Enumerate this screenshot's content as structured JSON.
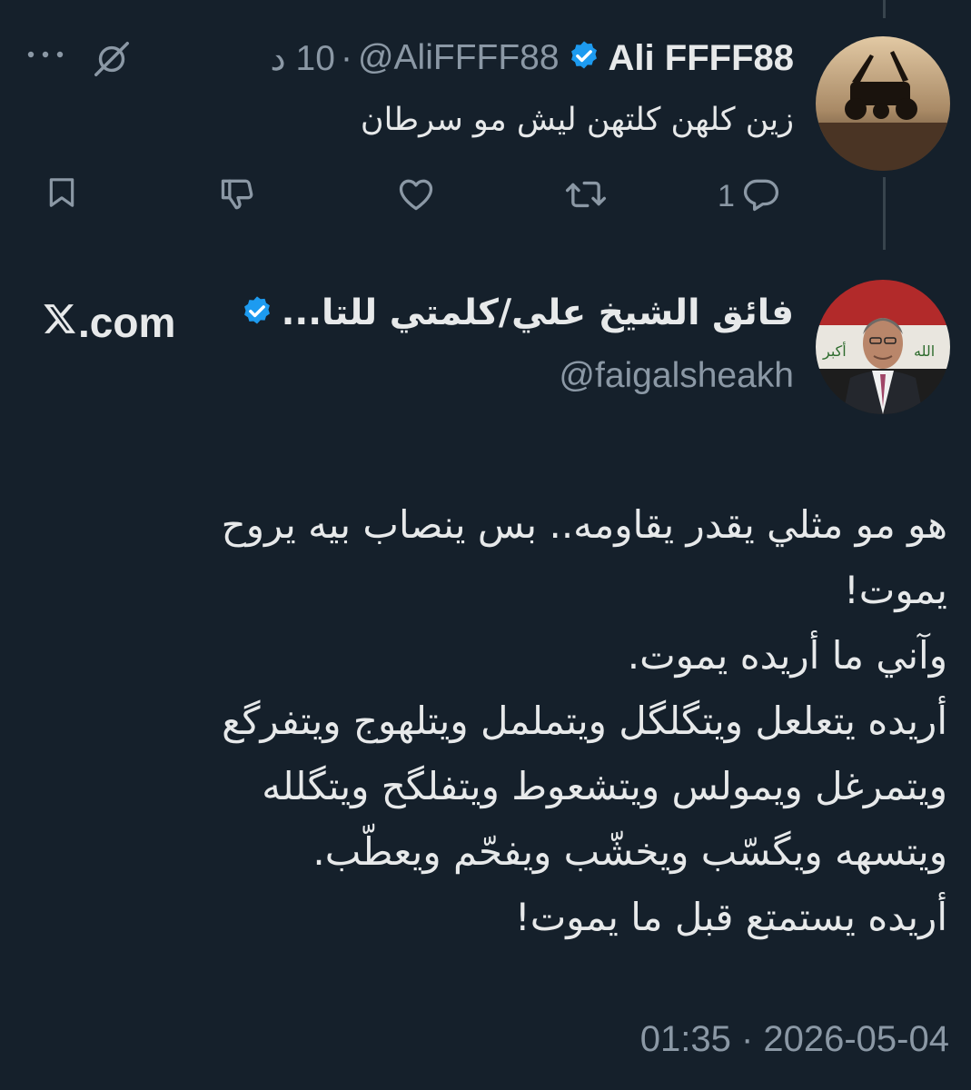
{
  "reply_tweet": {
    "display_name": "Ali FFFF88",
    "handle": "@AliFFFF88",
    "separator": "·",
    "time_ago": "10 د",
    "text": "زين كلهن كلتهن ليش مو سرطان",
    "reply_count": "1"
  },
  "quoted_tweet": {
    "display_name": "فائق الشيخ علي/كلمتي للتا...",
    "handle": "@faigalsheakh",
    "source_site": ".com",
    "body_lines": [
      "هو مو مثلي يقدر يقاومه.. بس ينصاب بيه يروح",
      "يموت!",
      "وآني ما أريده يموت.",
      "أريده يتعلعل ويتگلگل ويتململ ويتلهوج ويتفرگع",
      "ويتمرغل ويمولس ويتشعوط ويتفلگح ويتگلله",
      "ويتسهه ويگسّب ويخشّب ويفحّم ويعطّب.",
      "أريده يستمتع قبل ما يموت!"
    ],
    "timestamp": "01:35 · 2026-05-04"
  },
  "icons": {
    "verified": "verified-badge-icon",
    "mute": "mute-icon",
    "more": "more-icon",
    "bookmark": "bookmark-icon",
    "dislike": "dislike-icon",
    "like": "heart-icon",
    "retweet": "retweet-icon",
    "reply": "reply-icon",
    "x_logo": "x-logo-icon"
  },
  "colors": {
    "background": "#15202b",
    "text_primary": "#e7e9ea",
    "text_secondary": "#8b98a5",
    "verified_blue": "#1d9bf0",
    "thread_line": "#38444d"
  }
}
